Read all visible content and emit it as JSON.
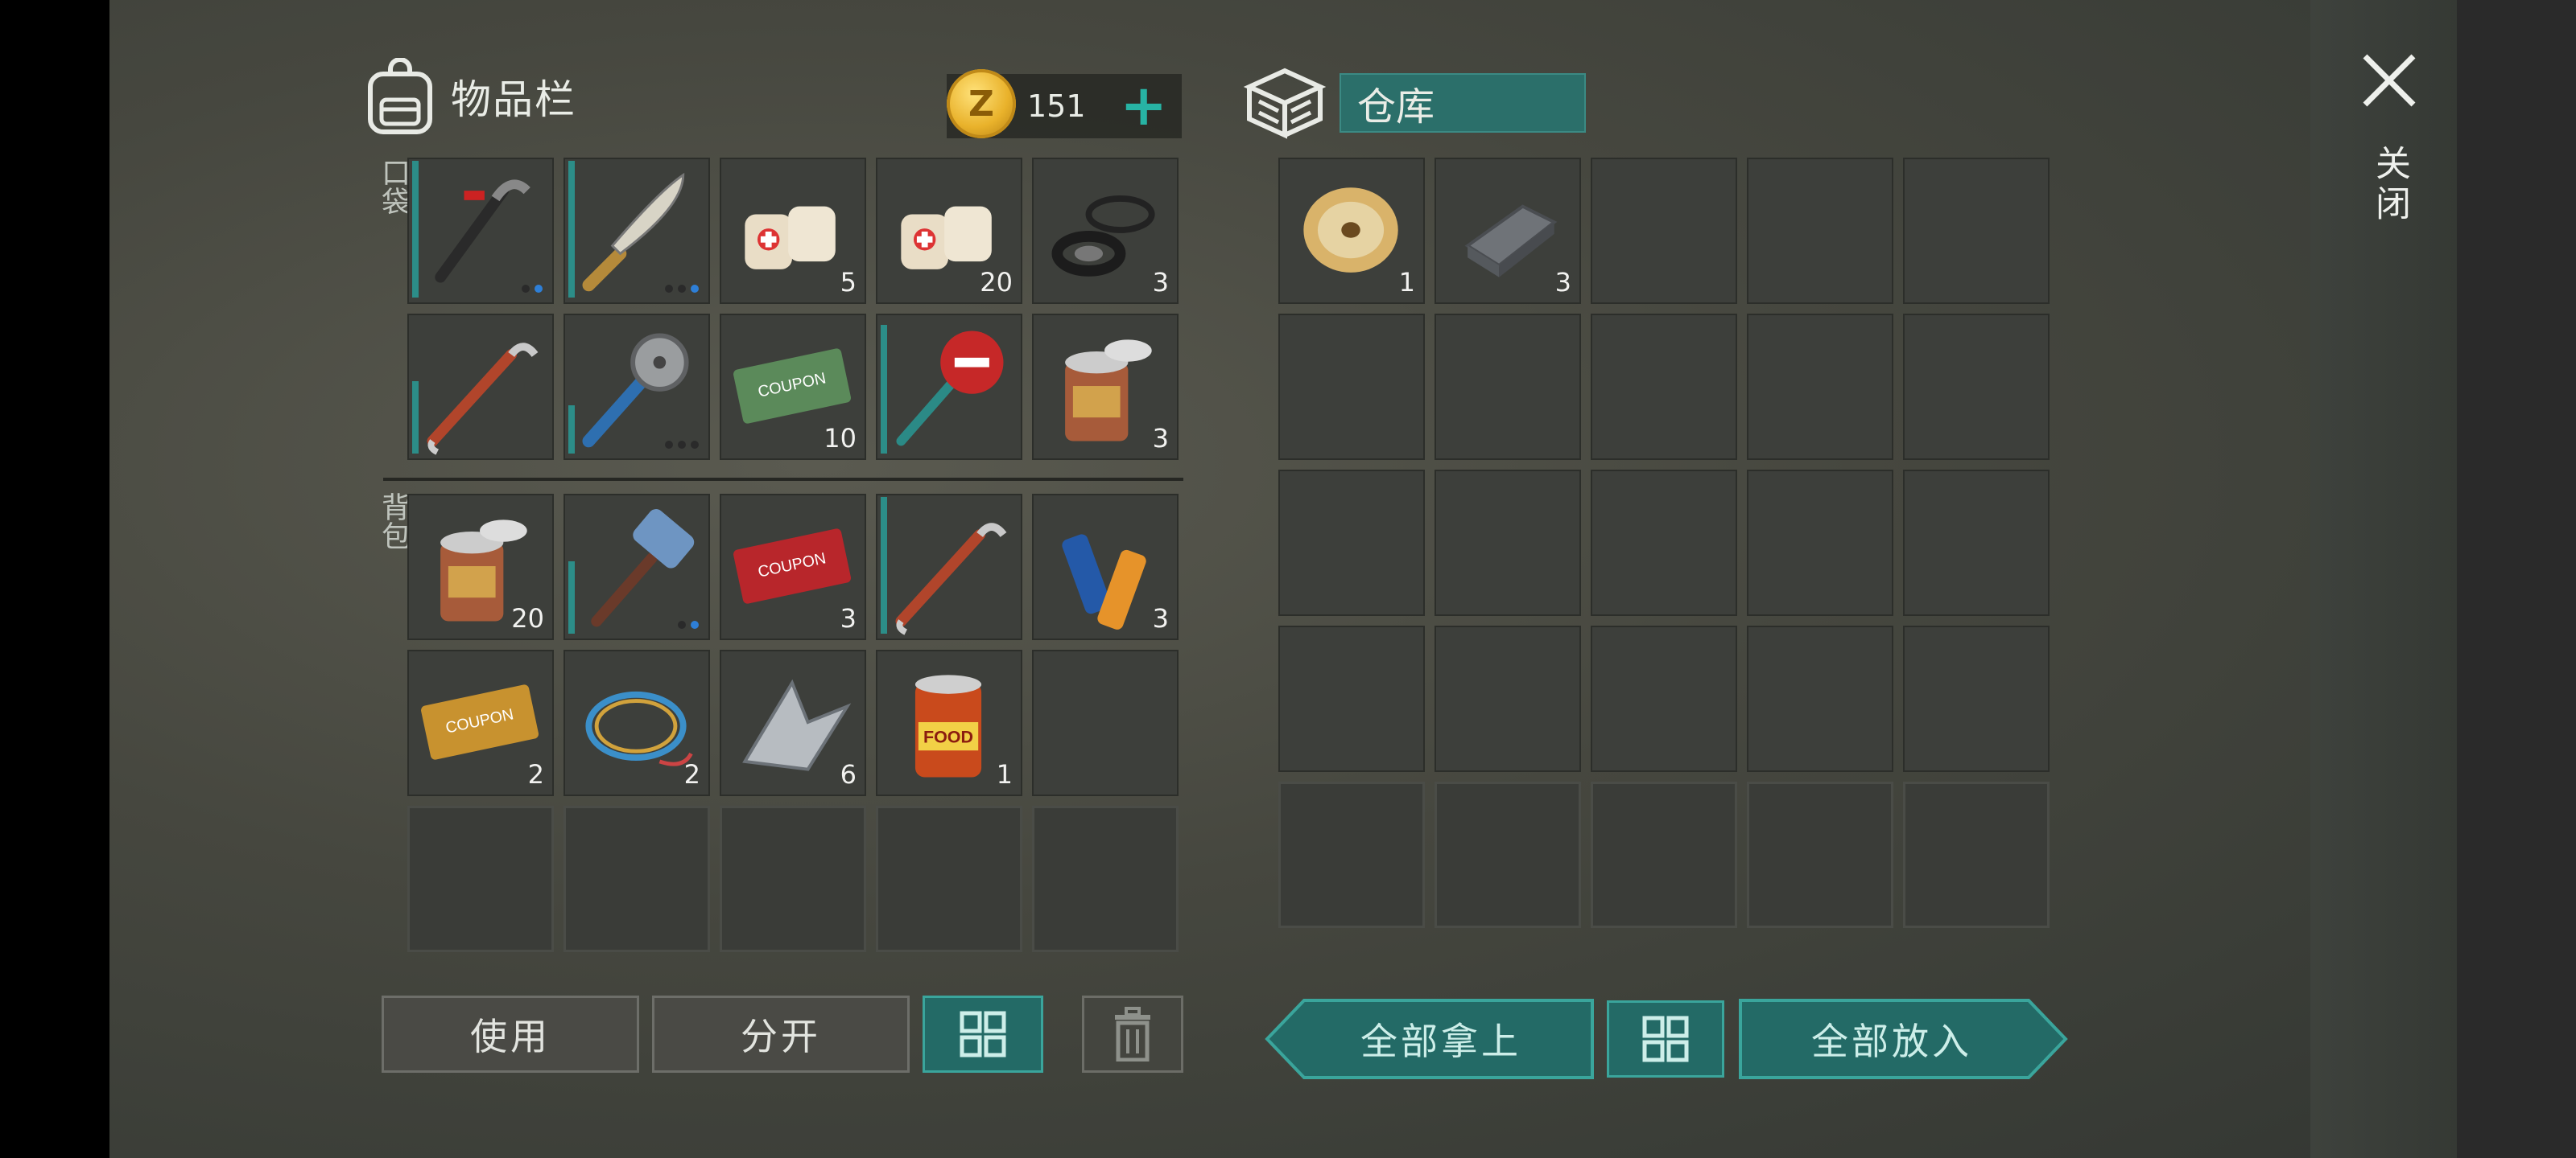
{
  "inventory": {
    "title": "物品栏",
    "coins": "151",
    "pocket_label": "口袋",
    "backpack_label": "背包",
    "pocket": [
      {
        "icon": "crowbar-icon",
        "count": "",
        "dots": [
          false,
          true
        ]
      },
      {
        "icon": "machete-icon",
        "count": "",
        "dots": [
          false,
          false,
          true
        ]
      },
      {
        "icon": "bandage-icon",
        "count": "5"
      },
      {
        "icon": "bandage-icon",
        "count": "20"
      },
      {
        "icon": "rubber-seal-icon",
        "count": "3"
      },
      {
        "icon": "crowbar-red-icon",
        "count": ""
      },
      {
        "icon": "saw-blade-club-icon",
        "count": "",
        "dots": [
          false,
          false,
          false
        ]
      },
      {
        "icon": "ration-coupon-icon",
        "count": "10"
      },
      {
        "icon": "stop-sign-weapon-icon",
        "count": ""
      },
      {
        "icon": "canned-food-open-icon",
        "count": "3"
      }
    ],
    "backpack": [
      {
        "icon": "canned-food-open-icon",
        "count": "20"
      },
      {
        "icon": "sledgehammer-icon",
        "count": "",
        "dots": [
          false,
          true
        ]
      },
      {
        "icon": "combat-gear-coupon-icon",
        "count": "3"
      },
      {
        "icon": "crowbar-red-icon",
        "count": ""
      },
      {
        "icon": "batteries-icon",
        "count": "3"
      },
      {
        "icon": "survival-kit-coupon-icon",
        "count": "2"
      },
      {
        "icon": "wire-coil-icon",
        "count": "2"
      },
      {
        "icon": "metal-scrap-icon",
        "count": "6"
      },
      {
        "icon": "food-can-icon",
        "count": "1"
      },
      {
        "icon": "",
        "count": ""
      }
    ]
  },
  "storage": {
    "title": "仓库",
    "items": [
      {
        "icon": "wire-spool-icon",
        "count": "1"
      },
      {
        "icon": "iron-ingot-icon",
        "count": "3"
      }
    ]
  },
  "buttons": {
    "use": "使用",
    "split": "分开",
    "take_all": "全部拿上",
    "put_all": "全部放入"
  },
  "close_label": "关闭"
}
